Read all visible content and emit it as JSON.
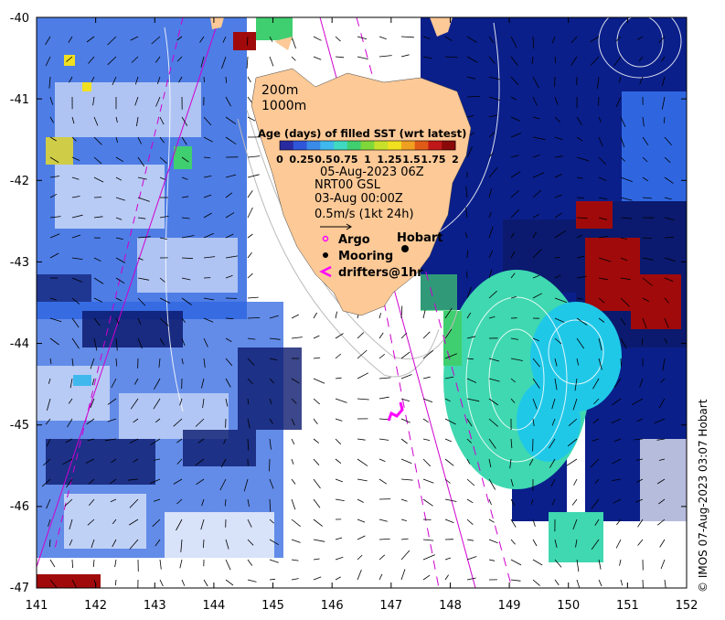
{
  "map": {
    "lon_range": [
      141,
      152
    ],
    "lat_range": [
      -47,
      -40
    ],
    "lon_ticks": [
      "141",
      "142",
      "143",
      "144",
      "145",
      "146",
      "147",
      "148",
      "149",
      "150",
      "151",
      "152"
    ],
    "lat_ticks": [
      "-40",
      "-41",
      "-42",
      "-43",
      "-44",
      "-45",
      "-46",
      "-47"
    ]
  },
  "colorbar": {
    "title": "Age (days) of filled SST (wrt latest)",
    "tick_labels": [
      "0",
      "0.25",
      "0.5",
      "0.75",
      "1",
      "1.25",
      "1.5",
      "1.75",
      "2"
    ],
    "colors": [
      "#2a2aa0",
      "#2f55d8",
      "#3a8ae8",
      "#3fb8ee",
      "#3fd8c0",
      "#40cf70",
      "#7fd83a",
      "#c8e02a",
      "#f0e020",
      "#f0a020",
      "#e05a18",
      "#c01818",
      "#8a0a0a"
    ]
  },
  "annotations": {
    "depth_200": "200m",
    "depth_1000": "1000m",
    "date": "05-Aug-2023 06Z",
    "product": "NRT00 GSL",
    "current_date": "03-Aug 00:00Z",
    "scale": "0.5m/s (1kt 24h)",
    "legend_argo": "Argo",
    "legend_mooring": "Mooring",
    "legend_drifters": "drifters@1hr",
    "city": "Hobart"
  },
  "copyright": "© IMOS 07-Aug-2023 03:07 Hobart",
  "colors": {
    "land": "#fcc997",
    "deep_blue": "#0a1f8a",
    "navy": "#0b1a6e",
    "teal": "#3fd8b0",
    "cyan": "#20c8e8",
    "mid_blue": "#2f66e0",
    "red": "#a00a0a",
    "magenta": "#d000d0"
  }
}
